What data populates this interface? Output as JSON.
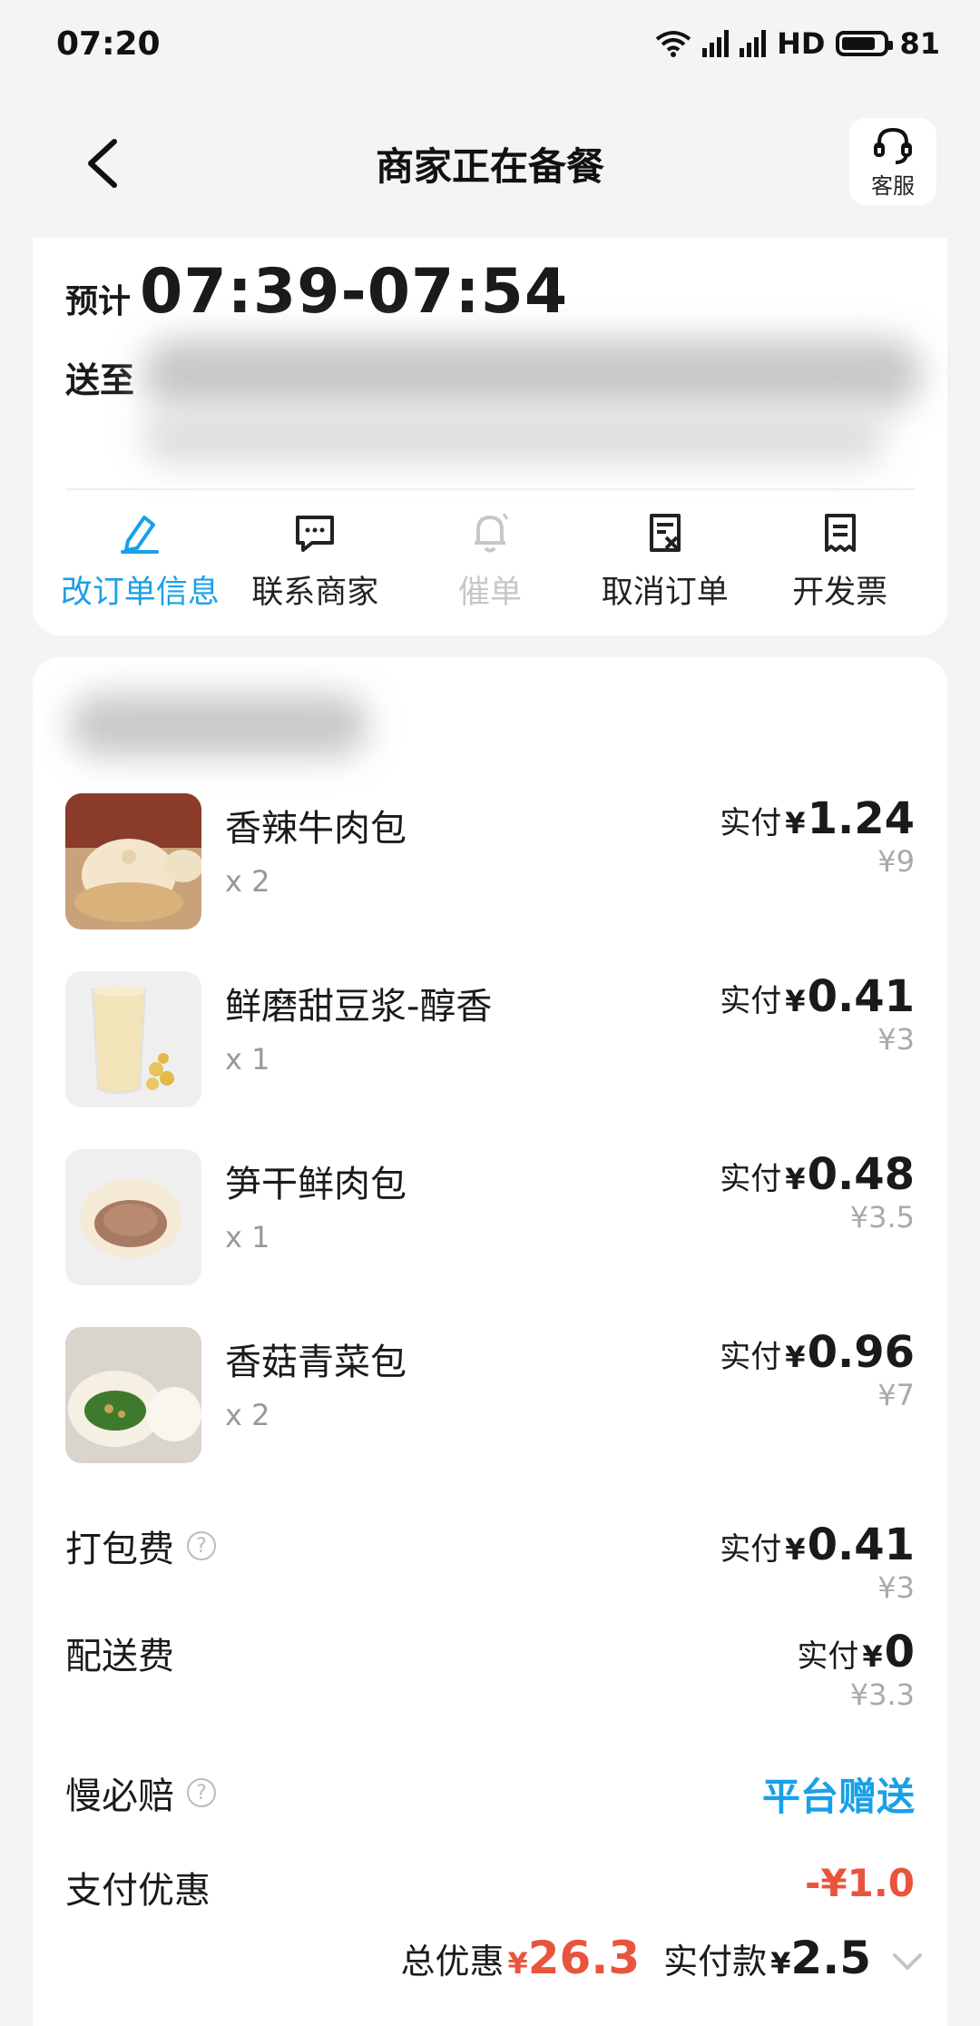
{
  "status_bar": {
    "time": "07:20",
    "network": "4G",
    "hd": "HD",
    "battery": "81"
  },
  "nav": {
    "title": "商家正在备餐",
    "service_label": "客服"
  },
  "delivery": {
    "eta_prefix": "预计",
    "eta_time": "07:39-07:54",
    "address_label": "送至"
  },
  "actions": [
    {
      "label": "改订单信息",
      "icon": "edit-icon",
      "state": "active"
    },
    {
      "label": "联系商家",
      "icon": "chat-icon",
      "state": "normal"
    },
    {
      "label": "催单",
      "icon": "bell-icon",
      "state": "disabled"
    },
    {
      "label": "取消订单",
      "icon": "cancel-order-icon",
      "state": "normal"
    },
    {
      "label": "开发票",
      "icon": "invoice-icon",
      "state": "normal"
    }
  ],
  "items": [
    {
      "name": "香辣牛肉包",
      "qty": "x 2",
      "paid_label": "实付",
      "paid_value": "1.24",
      "original": "¥9"
    },
    {
      "name": "鲜磨甜豆浆-醇香",
      "qty": "x 1",
      "paid_label": "实付",
      "paid_value": "0.41",
      "original": "¥3"
    },
    {
      "name": "笋干鲜肉包",
      "qty": "x 1",
      "paid_label": "实付",
      "paid_value": "0.48",
      "original": "¥3.5"
    },
    {
      "name": "香菇青菜包",
      "qty": "x 2",
      "paid_label": "实付",
      "paid_value": "0.96",
      "original": "¥7"
    }
  ],
  "fees": {
    "packing": {
      "name": "打包费",
      "paid_label": "实付",
      "paid_value": "0.41",
      "original": "¥3"
    },
    "delivery": {
      "name": "配送费",
      "paid_label": "实付",
      "paid_value": "0",
      "original": "¥3.3"
    },
    "late_comp": {
      "name": "慢必赔",
      "value": "平台赠送"
    },
    "pay_discount": {
      "name": "支付优惠",
      "value": "-¥1.0"
    }
  },
  "totals": {
    "discount_label": "总优惠",
    "discount_value": "26.3",
    "paid_label": "实付款",
    "paid_value": "2.5"
  },
  "currency": "¥",
  "colors": {
    "accent_blue": "#1aa0e8",
    "discount_red": "#e8553c",
    "background": "#f4f4f4"
  }
}
